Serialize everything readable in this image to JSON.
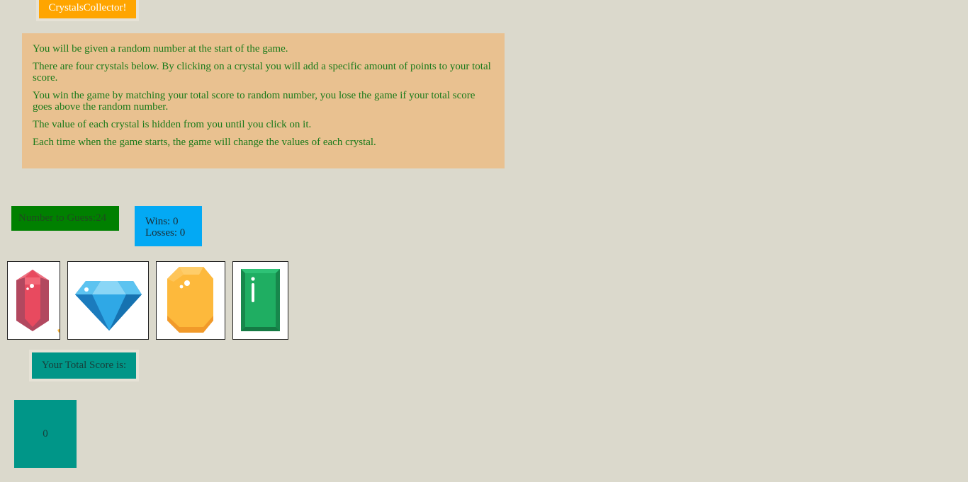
{
  "title": "CrystalsCollector!",
  "instructions": [
    "You will be given a random number at the start of the game.",
    "There are four crystals below. By clicking on a crystal you will add a specific amount of points to your total score.",
    "You win the game by matching your total score to random number, you lose the game if your total score goes above the random number.",
    "The value of each crystal is hidden from you until you click on it.",
    "Each time when the game starts, the game will change the values of each crystal."
  ],
  "target": {
    "label": "Number to Guess:",
    "value": "24"
  },
  "stats": {
    "wins_label": "Wins: 0",
    "losses_label": "Losses: 0"
  },
  "crystals": [
    {
      "icon": "red-crystal-icon",
      "color": "#e84a5f"
    },
    {
      "icon": "blue-diamond-icon",
      "color": "#29a8e0"
    },
    {
      "icon": "yellow-gem-icon",
      "color": "#fdb93c"
    },
    {
      "icon": "green-emerald-icon",
      "color": "#1fae62"
    }
  ],
  "score": {
    "label": "Your Total Score is:",
    "value": "0"
  }
}
